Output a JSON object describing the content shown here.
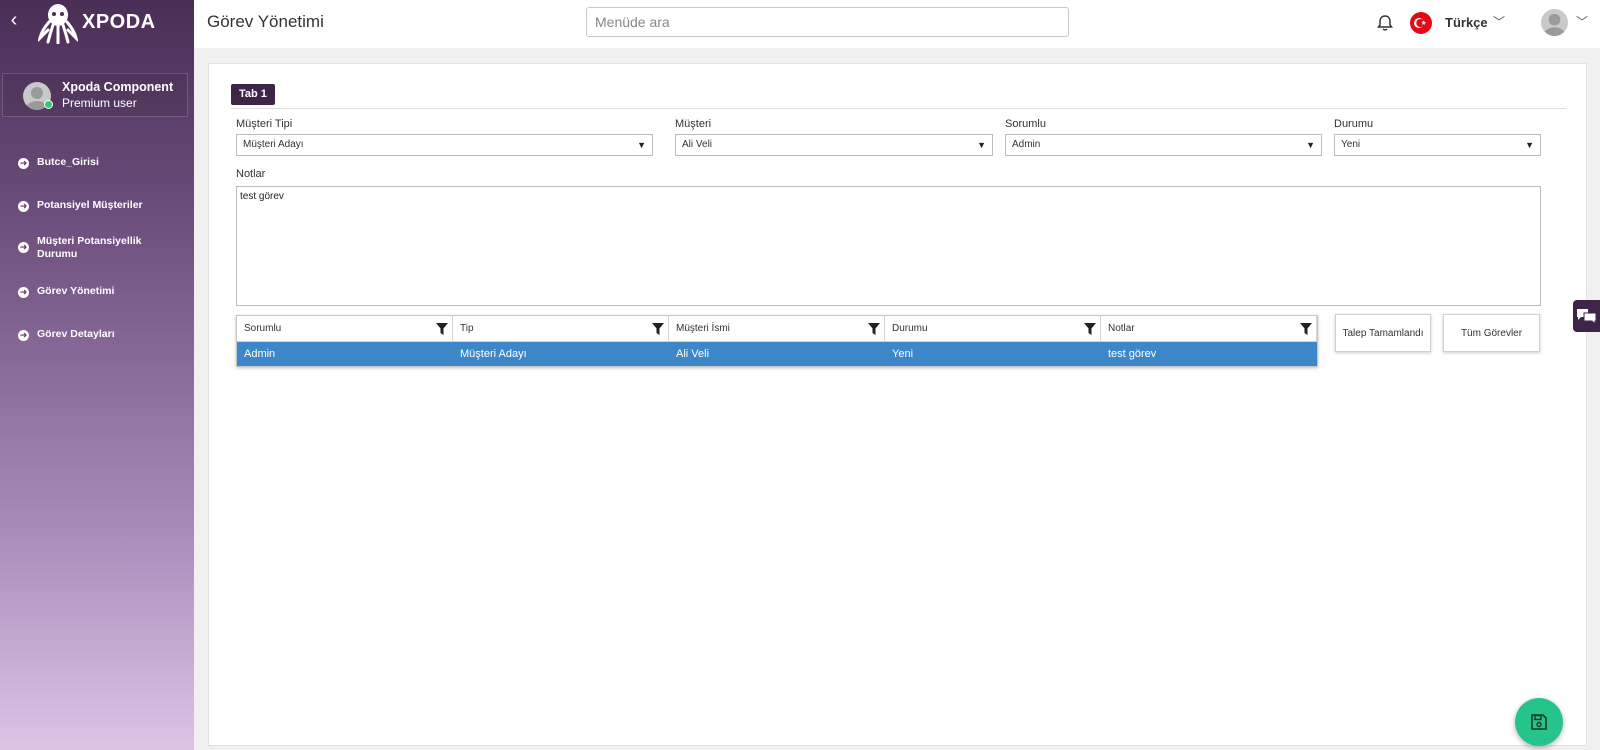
{
  "sidebar": {
    "brand": "XPODA",
    "back_icon": "chevron-left-icon",
    "user": {
      "name": "Xpoda Component",
      "role": "Premium user",
      "status_color": "#2ecc71"
    },
    "items": [
      {
        "label": "Butce_Girisi"
      },
      {
        "label": "Potansiyel Müşteriler"
      },
      {
        "label": "Müşteri Potansiyellik Durumu"
      },
      {
        "label": "Görev Yönetimi"
      },
      {
        "label": "Görev Detayları"
      }
    ]
  },
  "header": {
    "title": "Görev Yönetimi",
    "search_placeholder": "Menüde ara",
    "language": "Türkçe",
    "icons": [
      "bell-icon",
      "turkey-flag-icon",
      "user-avatar-icon",
      "chevron-down-icon"
    ]
  },
  "tabs": [
    {
      "label": "Tab 1"
    }
  ],
  "form": {
    "musteri_tipi": {
      "label": "Müşteri Tipi",
      "value": "Müşteri Adayı"
    },
    "musteri": {
      "label": "Müşteri",
      "value": "Ali Veli"
    },
    "sorumlu": {
      "label": "Sorumlu",
      "value": "Admin"
    },
    "durumu": {
      "label": "Durumu",
      "value": "Yeni"
    },
    "notlar": {
      "label": "Notlar",
      "value": "test görev"
    }
  },
  "grid": {
    "columns": [
      "Sorumlu",
      "Tip",
      "Müşteri İsmi",
      "Durumu",
      "Notlar"
    ],
    "rows": [
      [
        "Admin",
        "Müşteri Adayı",
        "Ali Veli",
        "Yeni",
        "test görev"
      ]
    ],
    "selected_row_color": "#3d87c9"
  },
  "buttons": {
    "talep_tamamlandi": "Talep Tamamlandı",
    "tum_gorevler": "Tüm Görevler"
  },
  "colors": {
    "accent_dark": "#3e2547",
    "fab": "#25c48c"
  }
}
